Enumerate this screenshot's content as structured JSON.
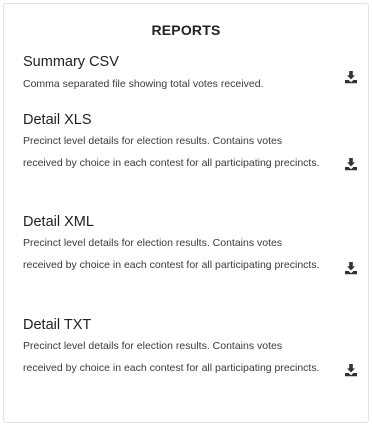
{
  "panel": {
    "title": "REPORTS"
  },
  "reports": [
    {
      "title": "Summary CSV",
      "description": "Comma separated file showing total votes received."
    },
    {
      "title": "Detail XLS",
      "description": "Precinct level details for election results. Contains votes received by choice in each contest for all participating precincts."
    },
    {
      "title": "Detail XML",
      "description": "Precinct level details for election results. Contains votes received by choice in each contest for all participating precincts."
    },
    {
      "title": "Detail TXT",
      "description": "Precinct level details for election results. Contains votes received by choice in each contest for all participating precincts."
    }
  ],
  "icons": {
    "download": "download-icon"
  },
  "colors": {
    "text": "#2b2b2b",
    "icon": "#333333",
    "border": "#e3e3e3"
  }
}
